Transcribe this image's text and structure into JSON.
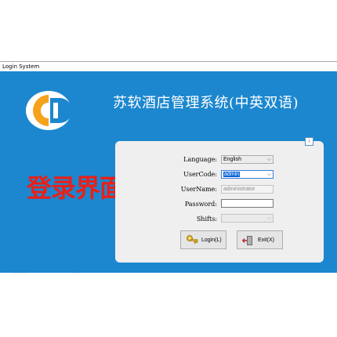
{
  "window": {
    "title": "Login System"
  },
  "app": {
    "title": "苏软酒店管理系统(中英双语)"
  },
  "caption": "登录界面",
  "help_icon_glyph": "i",
  "form": {
    "language": {
      "label": "Language:",
      "value": "English"
    },
    "usercode": {
      "label": "UserCode:",
      "value": "admin"
    },
    "username": {
      "label": "UserName:",
      "value": "administrator"
    },
    "password": {
      "label": "Password:",
      "value": ""
    },
    "shifts": {
      "label": "Shifts:",
      "value": ""
    }
  },
  "buttons": {
    "login": {
      "label": "Login(L)"
    },
    "exit": {
      "label": "Exit(X)"
    }
  },
  "footer": {
    "left": "…………",
    "right": "……"
  },
  "colors": {
    "panel": "#1c87cf",
    "caption": "#e8201a",
    "logo_orange": "#f5a21c",
    "logo_blue": "#1c87cf"
  }
}
